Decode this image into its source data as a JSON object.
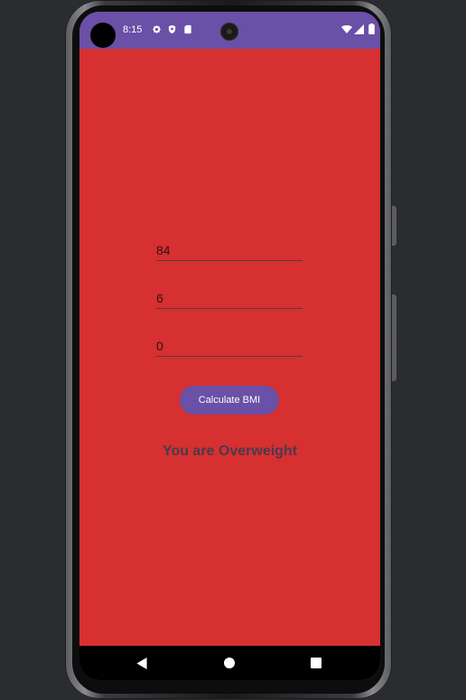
{
  "status_bar": {
    "time": "8:15",
    "icons_left": [
      "gear-icon",
      "shield-icon",
      "sd-card-icon"
    ],
    "icons_right": [
      "wifi-icon",
      "signal-icon",
      "battery-icon"
    ],
    "color": "#6a50a7"
  },
  "form": {
    "weight_value": "84",
    "height_feet_value": "6",
    "height_inches_value": "0"
  },
  "calculate_button": {
    "label": "Calculate BMI",
    "color": "#6a50a7"
  },
  "result": {
    "text": "You are Overweight",
    "background_color": "#d63031"
  },
  "nav_bar": {
    "buttons": [
      "back-icon",
      "home-icon",
      "recents-icon"
    ]
  }
}
